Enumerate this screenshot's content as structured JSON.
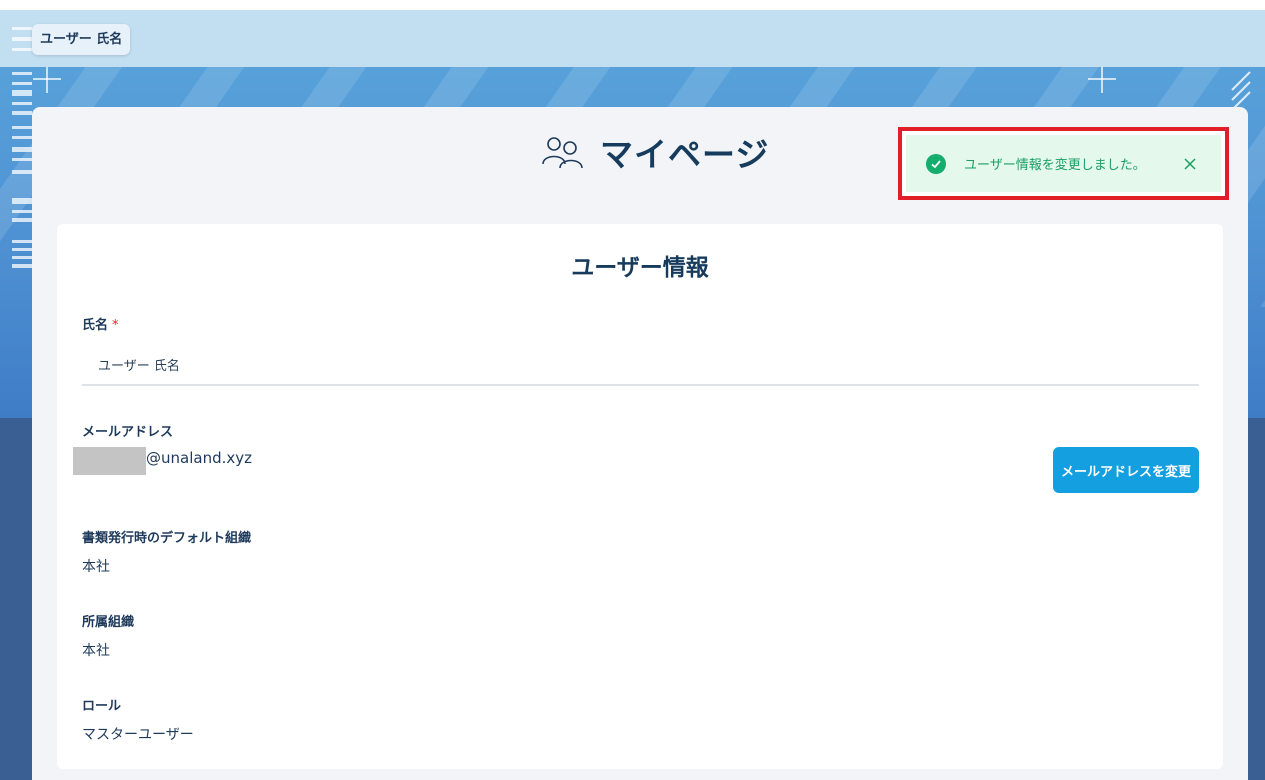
{
  "header": {
    "user_name": "ユーザー 氏名"
  },
  "page": {
    "title": "マイページ"
  },
  "toast": {
    "message": "ユーザー情報を変更しました。",
    "type": "success",
    "highlight_color": "#e01f26"
  },
  "user_info": {
    "section_title": "ユーザー情報",
    "name_label": "氏名",
    "required_mark": "*",
    "name_value": "ユーザー 氏名",
    "email_label": "メールアドレス",
    "email_domain": "@unaland.xyz",
    "change_email_button": "メールアドレスを変更",
    "default_org_label": "書類発行時のデフォルト組織",
    "default_org_value": "本社",
    "affiliation_label": "所属組織",
    "affiliation_value": "本社",
    "role_label": "ロール",
    "role_value": "マスターユーザー"
  },
  "colors": {
    "primary_button": "#14a0e0",
    "success": "#14ad6e",
    "title_text": "#163b5c"
  }
}
